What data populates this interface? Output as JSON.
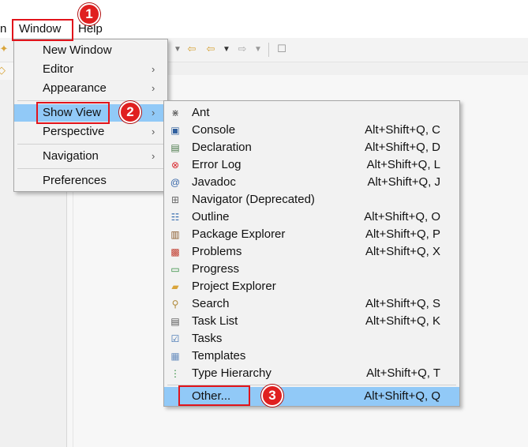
{
  "menubar": {
    "items": [
      {
        "label": "n"
      },
      {
        "label": "Window"
      },
      {
        "label": "Help"
      }
    ]
  },
  "window_menu": {
    "items": [
      {
        "label": "New Window",
        "submenu": false
      },
      {
        "label": "Editor",
        "submenu": true
      },
      {
        "label": "Appearance",
        "submenu": true
      },
      {
        "label": "Show View",
        "submenu": true
      },
      {
        "label": "Perspective",
        "submenu": true
      },
      {
        "label": "Navigation",
        "submenu": true
      },
      {
        "label": "Preferences",
        "submenu": false
      }
    ]
  },
  "show_view_menu": {
    "items": [
      {
        "label": "Ant",
        "shortcut": "",
        "icon": "ant-icon"
      },
      {
        "label": "Console",
        "shortcut": "Alt+Shift+Q, C",
        "icon": "console-icon"
      },
      {
        "label": "Declaration",
        "shortcut": "Alt+Shift+Q, D",
        "icon": "declaration-icon"
      },
      {
        "label": "Error Log",
        "shortcut": "Alt+Shift+Q, L",
        "icon": "error-log-icon"
      },
      {
        "label": "Javadoc",
        "shortcut": "Alt+Shift+Q, J",
        "icon": "javadoc-icon"
      },
      {
        "label": "Navigator (Deprecated)",
        "shortcut": "",
        "icon": "navigator-icon"
      },
      {
        "label": "Outline",
        "shortcut": "Alt+Shift+Q, O",
        "icon": "outline-icon"
      },
      {
        "label": "Package Explorer",
        "shortcut": "Alt+Shift+Q, P",
        "icon": "package-explorer-icon"
      },
      {
        "label": "Problems",
        "shortcut": "Alt+Shift+Q, X",
        "icon": "problems-icon"
      },
      {
        "label": "Progress",
        "shortcut": "",
        "icon": "progress-icon"
      },
      {
        "label": "Project Explorer",
        "shortcut": "",
        "icon": "project-explorer-icon"
      },
      {
        "label": "Search",
        "shortcut": "Alt+Shift+Q, S",
        "icon": "search-icon"
      },
      {
        "label": "Task List",
        "shortcut": "Alt+Shift+Q, K",
        "icon": "task-list-icon"
      },
      {
        "label": "Tasks",
        "shortcut": "",
        "icon": "tasks-icon"
      },
      {
        "label": "Templates",
        "shortcut": "",
        "icon": "templates-icon"
      },
      {
        "label": "Type Hierarchy",
        "shortcut": "Alt+Shift+Q, T",
        "icon": "type-hierarchy-icon"
      },
      {
        "label": "Other...",
        "shortcut": "Alt+Shift+Q, Q",
        "icon": ""
      }
    ]
  },
  "annotations": {
    "step1": "1",
    "step2": "2",
    "step3": "3",
    "color": "#e1141b"
  },
  "colors": {
    "highlight": "#91c9f7",
    "menu_bg": "#f2f2f2"
  }
}
